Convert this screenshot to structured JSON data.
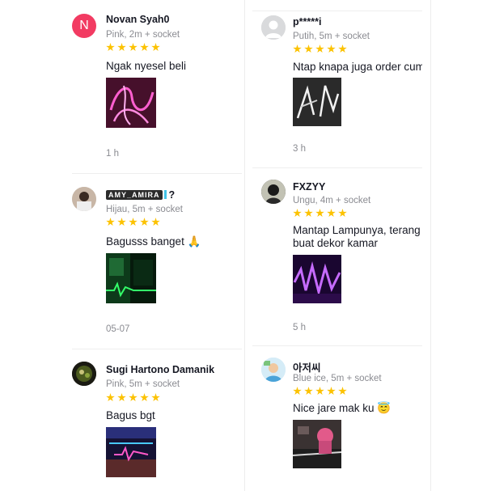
{
  "colors": {
    "star": "#fcc200",
    "avatar_n": "#f23b62",
    "text_secondary": "#8a8b91"
  },
  "reviews_left": [
    {
      "name": "Novan Syah0",
      "avatar_letter": "N",
      "variant": "Pink, 2m + socket",
      "rating": 5,
      "comment": "Ngak nyesel beli",
      "time": "1 h"
    },
    {
      "name_sticker": "AMY_AMIRA",
      "name_suffix": "?",
      "variant": "Hijau, 5m + socket",
      "rating": 5,
      "comment": "Bagusss banget 🙏",
      "time": "05-07"
    },
    {
      "name": "Sugi Hartono Damanik",
      "variant": "Pink, 5m + socket",
      "rating": 5,
      "comment": "Bagus bgt"
    }
  ],
  "reviews_right": [
    {
      "name": "p*****i",
      "variant": "Putih, 5m + socket",
      "rating": 5,
      "comment": "Ntap knapa juga order cum",
      "time": "3 h"
    },
    {
      "name": "FXZYY",
      "variant": "Ungu, 4m + socket",
      "rating": 5,
      "comment_line1": "Mantap Lampunya, terang",
      "comment_line2": "buat dekor kamar",
      "time": "5 h"
    },
    {
      "name": "아저씨",
      "variant": "Blue ice, 5m + socket",
      "rating": 5,
      "comment": "Nice jare mak ku 😇"
    }
  ]
}
